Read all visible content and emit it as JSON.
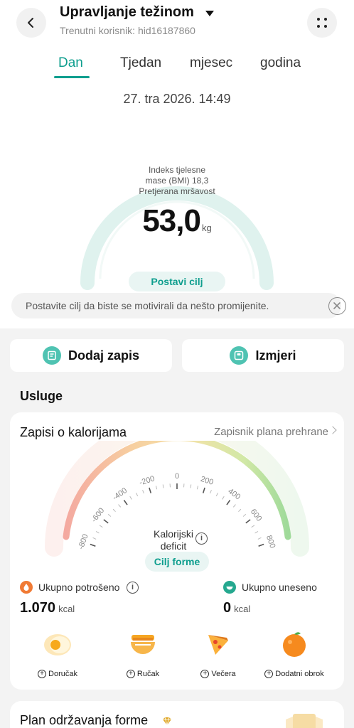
{
  "header": {
    "title": "Upravljanje težinom",
    "subtitle": "Trenutni korisnik: hid16187860"
  },
  "tabs": [
    "Dan",
    "Tjedan",
    "mjesec",
    "godina"
  ],
  "active_tab": "Dan",
  "date": "27. tra 2026. 14:49",
  "weight": {
    "bmi_line1": "Indeks tjelesne",
    "bmi_line2": "mase (BMI) 18,3",
    "bmi_line3": "Pretjerana mršavost",
    "value": "53,0",
    "unit": "kg",
    "goal_button": "Postavi cilj"
  },
  "banner": {
    "text": "Postavite cilj da biste se motivirali da nešto promijenite."
  },
  "actions": {
    "add": "Dodaj zapis",
    "measure": "Izmjeri"
  },
  "services_title": "Usluge",
  "calories": {
    "title": "Zapisi o kalorijama",
    "link": "Zapisnik plana prehrane",
    "scale_ticks": [
      "-800",
      "-600",
      "-400",
      "-200",
      "0",
      "200",
      "400",
      "600",
      "800"
    ],
    "deficit_line1": "Kalorijski",
    "deficit_line2": "deficit",
    "goal_button": "Cilj forme",
    "consumed_label": "Ukupno potrošeno",
    "consumed_value": "1.070",
    "consumed_unit": "kcal",
    "intake_label": "Ukupno uneseno",
    "intake_value": "0",
    "intake_unit": "kcal",
    "meals": [
      "Doručak",
      "Ručak",
      "Večera",
      "Dodatni obrok"
    ]
  },
  "plan": {
    "title": "Plan održavanja forme"
  },
  "colors": {
    "accent": "#0e9e8e",
    "gauge_ring": "#dff2ee"
  }
}
